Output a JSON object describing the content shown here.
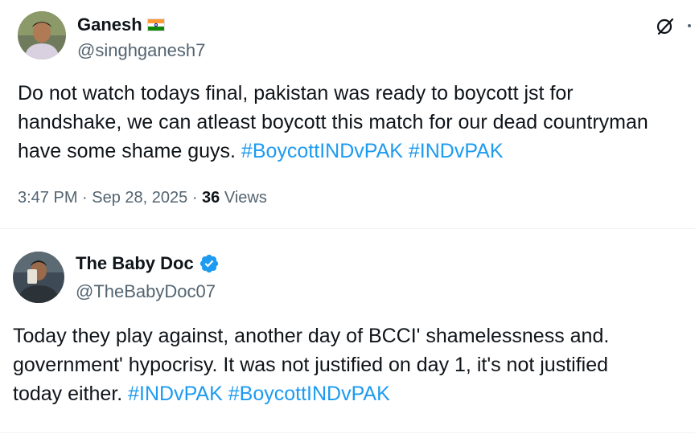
{
  "tweets": [
    {
      "name": "Ganesh",
      "handle": "@singhganesh7",
      "lines": [
        [
          {
            "t": "Do not watch todays final, pakistan was ready to boycott jst for"
          }
        ],
        [
          {
            "t": "handshake, we can atleast boycott this match for our dead countryman"
          }
        ],
        [
          {
            "t": "have some shame guys. "
          },
          {
            "t": "#BoycottINDvPAK",
            "tag": true
          },
          {
            "t": " "
          },
          {
            "t": "#INDvPAK",
            "tag": true
          }
        ]
      ],
      "time": "3:47 PM",
      "dot1": " · ",
      "date": "Sep 28, 2025",
      "dot2": " · ",
      "views_count": "36",
      "views_label": " Views",
      "flag_icon": "india-flag-icon",
      "action_icon": "grok-icon"
    },
    {
      "name": "The Baby Doc",
      "handle": "@TheBabyDoc07",
      "lines": [
        [
          {
            "t": "Today they play against, another day of BCCI' shamelessness and."
          }
        ],
        [
          {
            "t": "government' hypocrisy. It was not justified on day 1, it's not justified"
          }
        ],
        [
          {
            "t": "today either. "
          },
          {
            "t": "#INDvPAK",
            "tag": true
          },
          {
            "t": " "
          },
          {
            "t": "#BoycottINDvPAK",
            "tag": true
          }
        ]
      ],
      "verified_color": "#1d9bf0"
    }
  ],
  "colors": {
    "hashtag": "#1d9bf0",
    "secondary": "#536471",
    "text": "#0f1419"
  }
}
